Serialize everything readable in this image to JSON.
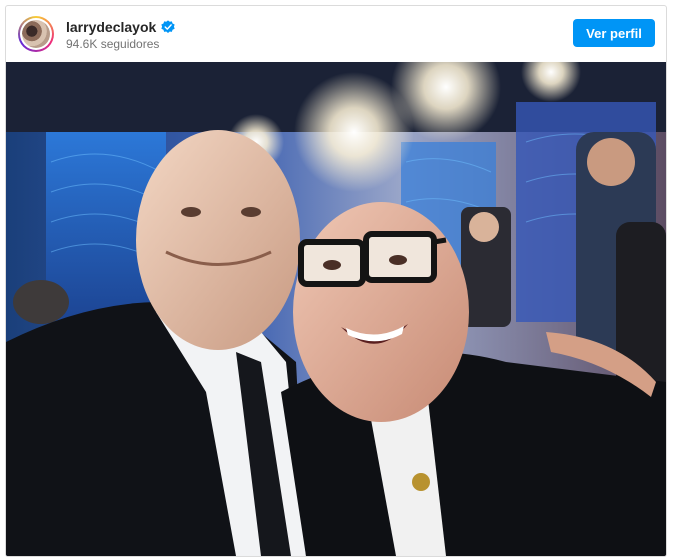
{
  "post": {
    "username": "larrydeclayok",
    "verified": true,
    "verified_icon": "verified-badge-icon",
    "followers": "94.6K seguidores",
    "follow_button_label": "Ver perfil",
    "accent_color": "#0095f6",
    "image": "Two smiling bald men in dark suits taking a selfie in a TV studio with bright lights and blue LED screens behind them"
  }
}
